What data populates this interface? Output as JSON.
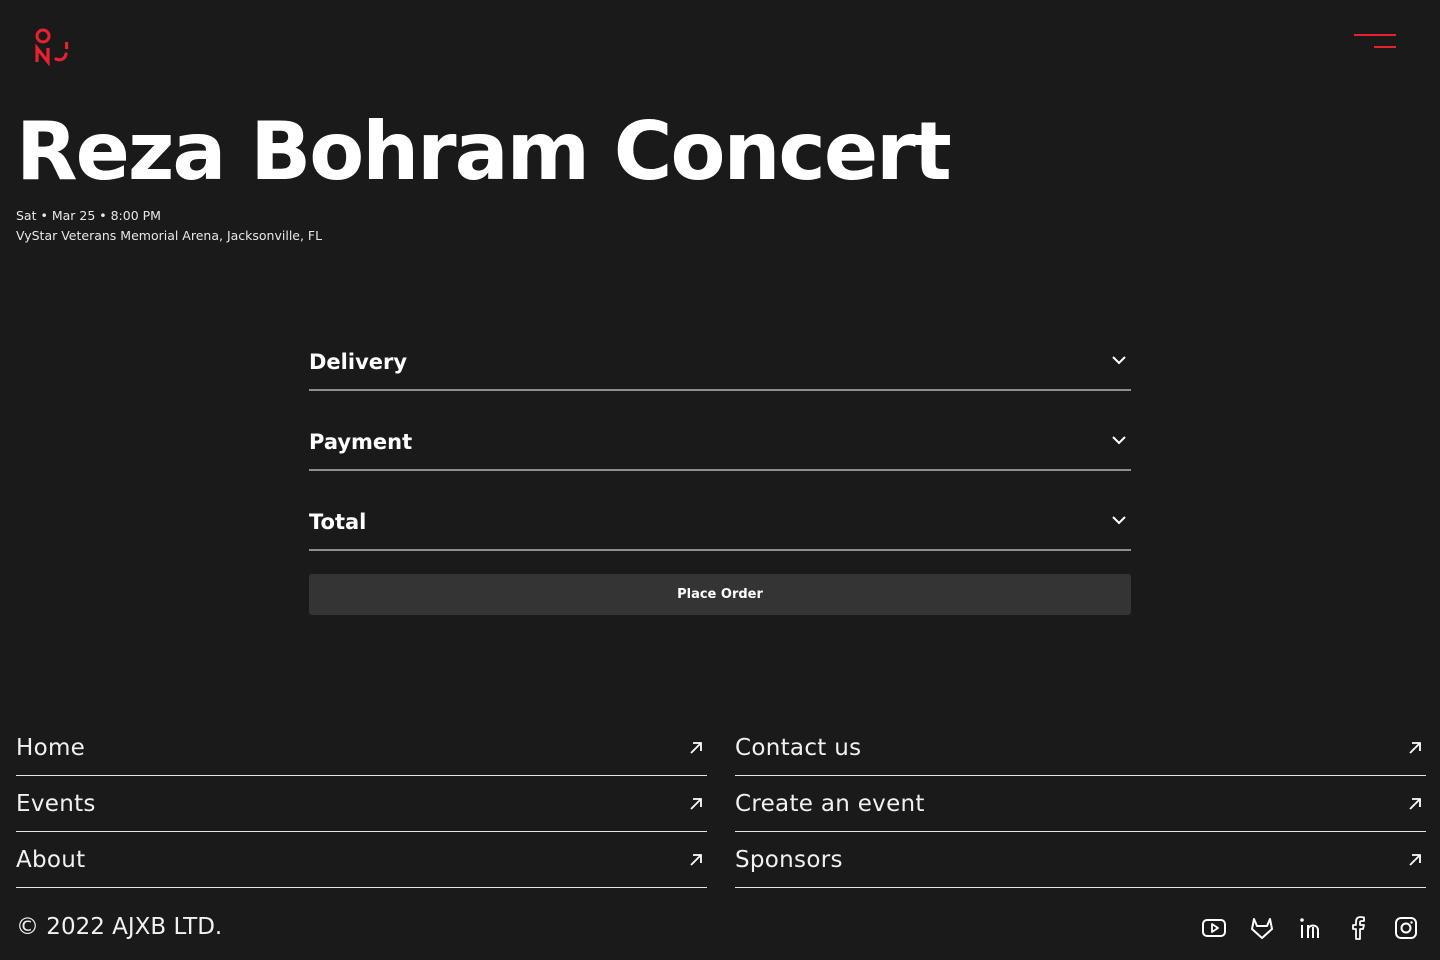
{
  "brand": {
    "logo_icon": "brand-logo-icon",
    "accent_color": "#e8212e"
  },
  "header": {
    "menu_icon": "hamburger-menu-icon"
  },
  "event": {
    "title": "Reza Bohram Concert",
    "date_line": "Sat • Mar 25 • 8:00 PM",
    "venue_line": "VyStar Veterans Memorial Arena, Jacksonville, FL"
  },
  "checkout": {
    "sections": [
      {
        "label": "Delivery",
        "icon": "chevron-down-icon"
      },
      {
        "label": "Payment",
        "icon": "chevron-down-icon"
      },
      {
        "label": "Total",
        "icon": "chevron-down-icon"
      }
    ],
    "place_order_label": "Place Order"
  },
  "footer": {
    "left_links": [
      {
        "label": "Home",
        "icon": "arrow-up-right-icon"
      },
      {
        "label": "Events",
        "icon": "arrow-up-right-icon"
      },
      {
        "label": "About",
        "icon": "arrow-up-right-icon"
      }
    ],
    "right_links": [
      {
        "label": "Contact us",
        "icon": "arrow-up-right-icon"
      },
      {
        "label": "Create an event",
        "icon": "arrow-up-right-icon"
      },
      {
        "label": "Sponsors",
        "icon": "arrow-up-right-icon"
      }
    ],
    "copyright": "© 2022 AJXB LTD.",
    "socials": [
      "youtube-icon",
      "gitlab-icon",
      "linkedin-icon",
      "facebook-icon",
      "instagram-icon"
    ]
  },
  "colors": {
    "background": "#1b1a1b",
    "divider": "#8d8d8d",
    "button_bg": "#343434",
    "text": "#ffffff"
  }
}
